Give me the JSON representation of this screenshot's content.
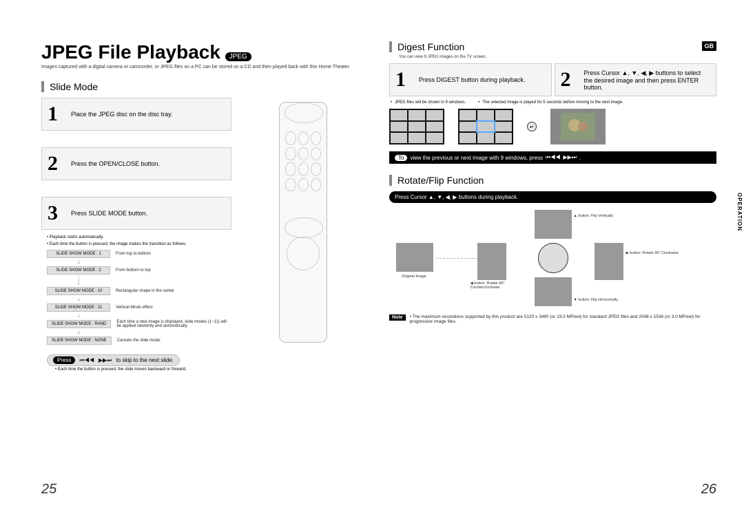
{
  "main_title": "JPEG File Playback",
  "jpeg_badge": "JPEG",
  "gb": "GB",
  "intro": "Images captured with a digital camera or camcorder, or JPEG files on a PC can be stored on a CD and then played back with this Home Theater.",
  "slide_mode": {
    "heading": "Slide Mode",
    "steps": [
      "Place the JPEG disc on the disc tray.",
      "Press the OPEN/CLOSE button.",
      "Press SLIDE MODE button."
    ],
    "bullets": [
      "Playback starts automatically.",
      "Each time the button is pressed, the image makes the transition as follows:"
    ],
    "modes": [
      {
        "label": "SLIDE SHOW MODE : 1",
        "desc": "From top to bottom"
      },
      {
        "label": "SLIDE SHOW MODE : 2",
        "desc": "From bottom to top"
      },
      {
        "label": "SLIDE SHOW MODE : 10",
        "desc": "Rectangular shape in the center"
      },
      {
        "label": "SLIDE SHOW MODE : 11",
        "desc": "Vertical blinds effect"
      },
      {
        "label": "SLIDE SHOW MODE : RAND",
        "desc": "Each time a new image is displayed, slide modes (1~11) will be applied randomly and automatically."
      },
      {
        "label": "SLIDE SHOW MODE : NONE",
        "desc": "Cancels the slide mode."
      }
    ],
    "skip_prefix": "Press",
    "skip_text": "to skip to the next slide.",
    "skip_note": "Each time the button is pressed, the slide moves backward or forward."
  },
  "digest": {
    "heading": "Digest Function",
    "subnote": "You can view 9 JPEG images on the TV screen.",
    "step1": "Press DIGEST button during playback.",
    "step2": "Press Cursor ▲, ▼, ◀, ▶ buttons to select the desired image and then press ENTER button.",
    "sub1": "JPEG files will be shown in 9 windows.",
    "sub2": "The selected image is played for 5 seconds before moving to the next image.",
    "strip_prefix": "To",
    "strip_text": "view the previous or next image with 9 windows, press"
  },
  "rotate": {
    "heading": "Rotate/Flip Function",
    "bar": "Press Cursor ▲, ▼, ◀, ▶ buttons during playback.",
    "labels": {
      "orig": "Original Image",
      "up": "▲ button: Flip Vertically",
      "down": "▼ button: Flip Horizontally",
      "left": "◀ button: Rotate 90° Counterclockwise",
      "right": "▶ button: Rotate 90° Clockwise"
    }
  },
  "note": {
    "tag": "Note",
    "text": "The maximum resolutions supported by this product are 5120 x 3480 (or 19.0 MPixel) for standard JPEG files and 2048 x 1536 (or 3.0 MPixel) for progressive image files."
  },
  "side_tab": "OPERATION",
  "pages": {
    "left": "25",
    "right": "26"
  }
}
